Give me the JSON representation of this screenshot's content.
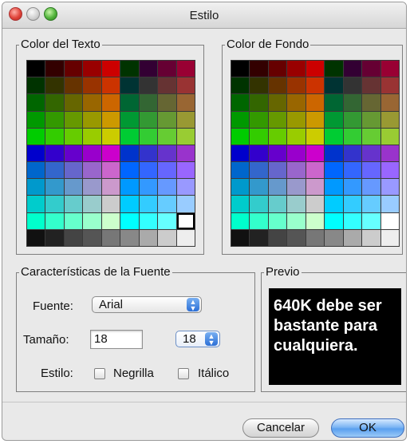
{
  "window": {
    "title": "Estilo"
  },
  "text_color": {
    "label": "Color del Texto",
    "selected": "#ffffff",
    "colors": [
      [
        "#000000",
        "#330000",
        "#660000",
        "#990000",
        "#cc0000",
        "#003300",
        "#330033",
        "#660033",
        "#990033"
      ],
      [
        "#003300",
        "#333300",
        "#663300",
        "#993300",
        "#cc3300",
        "#003333",
        "#333333",
        "#663333",
        "#993333"
      ],
      [
        "#006600",
        "#336600",
        "#666600",
        "#996600",
        "#cc6600",
        "#006633",
        "#336633",
        "#666633",
        "#996633"
      ],
      [
        "#009900",
        "#339900",
        "#669900",
        "#999900",
        "#cc9900",
        "#009933",
        "#339933",
        "#669933",
        "#999933"
      ],
      [
        "#00cc00",
        "#33cc00",
        "#66cc00",
        "#99cc00",
        "#cccc00",
        "#00cc33",
        "#33cc33",
        "#66cc33",
        "#99cc33"
      ],
      [
        "#0000cc",
        "#3300cc",
        "#6600cc",
        "#9900cc",
        "#cc00cc",
        "#0033cc",
        "#3333cc",
        "#6633cc",
        "#9933cc"
      ],
      [
        "#0066cc",
        "#3366cc",
        "#6666cc",
        "#9966cc",
        "#cc66cc",
        "#0066ff",
        "#3366ff",
        "#6666ff",
        "#9966ff"
      ],
      [
        "#0099cc",
        "#3399cc",
        "#6699cc",
        "#9999cc",
        "#cc99cc",
        "#0099ff",
        "#3399ff",
        "#6699ff",
        "#9999ff"
      ],
      [
        "#00cccc",
        "#33cccc",
        "#66cccc",
        "#99cccc",
        "#cccccc",
        "#00ccff",
        "#33ccff",
        "#66ccff",
        "#99ccff"
      ],
      [
        "#00ffcc",
        "#33ffcc",
        "#66ffcc",
        "#99ffcc",
        "#ccffcc",
        "#00ffff",
        "#33ffff",
        "#66ffff",
        "#ffffff"
      ],
      [
        "#111111",
        "#222222",
        "#444444",
        "#555555",
        "#777777",
        "#888888",
        "#aaaaaa",
        "#cccccc",
        "#eeeeee"
      ]
    ]
  },
  "background_color": {
    "label": "Color de Fondo",
    "selected": "#000000",
    "colors": [
      [
        "#000000",
        "#330000",
        "#660000",
        "#990000",
        "#cc0000",
        "#003300",
        "#330033",
        "#660033",
        "#990033"
      ],
      [
        "#003300",
        "#333300",
        "#663300",
        "#993300",
        "#cc3300",
        "#003333",
        "#333333",
        "#663333",
        "#993333"
      ],
      [
        "#006600",
        "#336600",
        "#666600",
        "#996600",
        "#cc6600",
        "#006633",
        "#336633",
        "#666633",
        "#996633"
      ],
      [
        "#009900",
        "#339900",
        "#669900",
        "#999900",
        "#cc9900",
        "#009933",
        "#339933",
        "#669933",
        "#999933"
      ],
      [
        "#00cc00",
        "#33cc00",
        "#66cc00",
        "#99cc00",
        "#cccc00",
        "#00cc33",
        "#33cc33",
        "#66cc33",
        "#99cc33"
      ],
      [
        "#0000cc",
        "#3300cc",
        "#6600cc",
        "#9900cc",
        "#cc00cc",
        "#0033cc",
        "#3333cc",
        "#6633cc",
        "#9933cc"
      ],
      [
        "#0066cc",
        "#3366cc",
        "#6666cc",
        "#9966cc",
        "#cc66cc",
        "#0066ff",
        "#3366ff",
        "#6666ff",
        "#9966ff"
      ],
      [
        "#0099cc",
        "#3399cc",
        "#6699cc",
        "#9999cc",
        "#cc99cc",
        "#0099ff",
        "#3399ff",
        "#6699ff",
        "#9999ff"
      ],
      [
        "#00cccc",
        "#33cccc",
        "#66cccc",
        "#99cccc",
        "#cccccc",
        "#00ccff",
        "#33ccff",
        "#66ccff",
        "#99ccff"
      ],
      [
        "#00ffcc",
        "#33ffcc",
        "#66ffcc",
        "#99ffcc",
        "#ccffcc",
        "#00ffff",
        "#33ffff",
        "#66ffff",
        "#ffffff"
      ],
      [
        "#111111",
        "#222222",
        "#444444",
        "#555555",
        "#777777",
        "#888888",
        "#aaaaaa",
        "#cccccc",
        "#eeeeee"
      ]
    ]
  },
  "font": {
    "group_label": "Características de la Fuente",
    "font_label": "Fuente:",
    "font_value": "Arial",
    "size_label": "Tamaño:",
    "size_value": "18",
    "size_popup_value": "18",
    "style_label": "Estilo:",
    "bold_label": "Negrilla",
    "bold_checked": false,
    "italic_label": "Itálico",
    "italic_checked": false,
    "popup_arrow_icon": "updown-arrows-icon"
  },
  "preview": {
    "label": "Previo",
    "text": "640K debe ser bastante para cualquiera.",
    "text_color": "#ffffff",
    "background": "#000000"
  },
  "buttons": {
    "cancel_label": "Cancelar",
    "ok_label": "OK"
  }
}
